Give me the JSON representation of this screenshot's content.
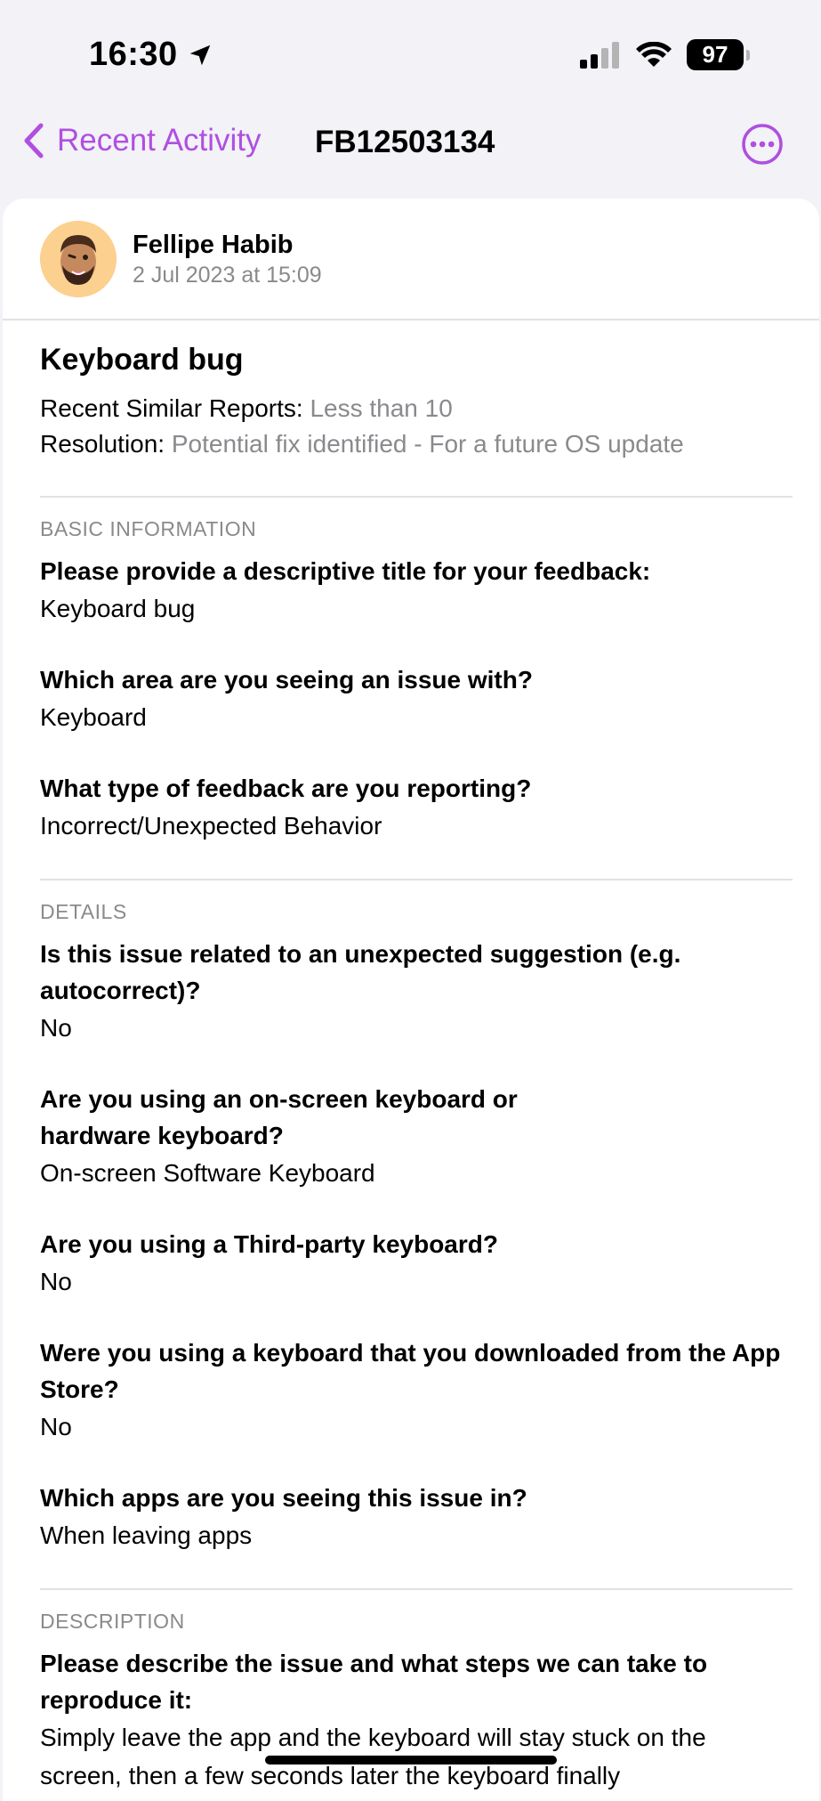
{
  "status_bar": {
    "time": "16:30",
    "battery": "97"
  },
  "nav": {
    "back_label": "Recent Activity",
    "title": "FB12503134",
    "accent": "#b04fe0"
  },
  "author": {
    "name": "Fellipe Habib",
    "date": "2 Jul 2023 at 15:09"
  },
  "report": {
    "title": "Keyboard bug",
    "similar_label": "Recent Similar Reports:",
    "similar_value": "Less than 10",
    "resolution_label": "Resolution:",
    "resolution_value": "Potential fix identified - For a future OS update"
  },
  "sections": [
    {
      "heading": "BASIC INFORMATION",
      "items": [
        {
          "q": "Please provide a descriptive title for your feedback:",
          "a": "Keyboard bug"
        },
        {
          "q": "Which area are you seeing an issue with?",
          "a": "Keyboard"
        },
        {
          "q": "What type of feedback are you reporting?",
          "a": "Incorrect/Unexpected Behavior"
        }
      ]
    },
    {
      "heading": "DETAILS",
      "items": [
        {
          "q": "Is this issue related to an unexpected suggestion (e.g. autocorrect)?",
          "a": "No"
        },
        {
          "q": "Are you using an on-screen keyboard or hardware keyboard?",
          "a": "On-screen Software Keyboard"
        },
        {
          "q": "Are you using a Third-party keyboard?",
          "a": "No"
        },
        {
          "q": "Were you using a keyboard that you downloaded from the App Store?",
          "a": "No"
        },
        {
          "q": "Which apps are you seeing this issue in?",
          "a": "When leaving apps"
        }
      ]
    },
    {
      "heading": "DESCRIPTION",
      "items": [
        {
          "q": "Please describe the issue and what steps we can take to reproduce it:",
          "a": "Simply leave the app and the keyboard will stay stuck on the screen, then a few seconds later the keyboard finally"
        }
      ]
    }
  ]
}
